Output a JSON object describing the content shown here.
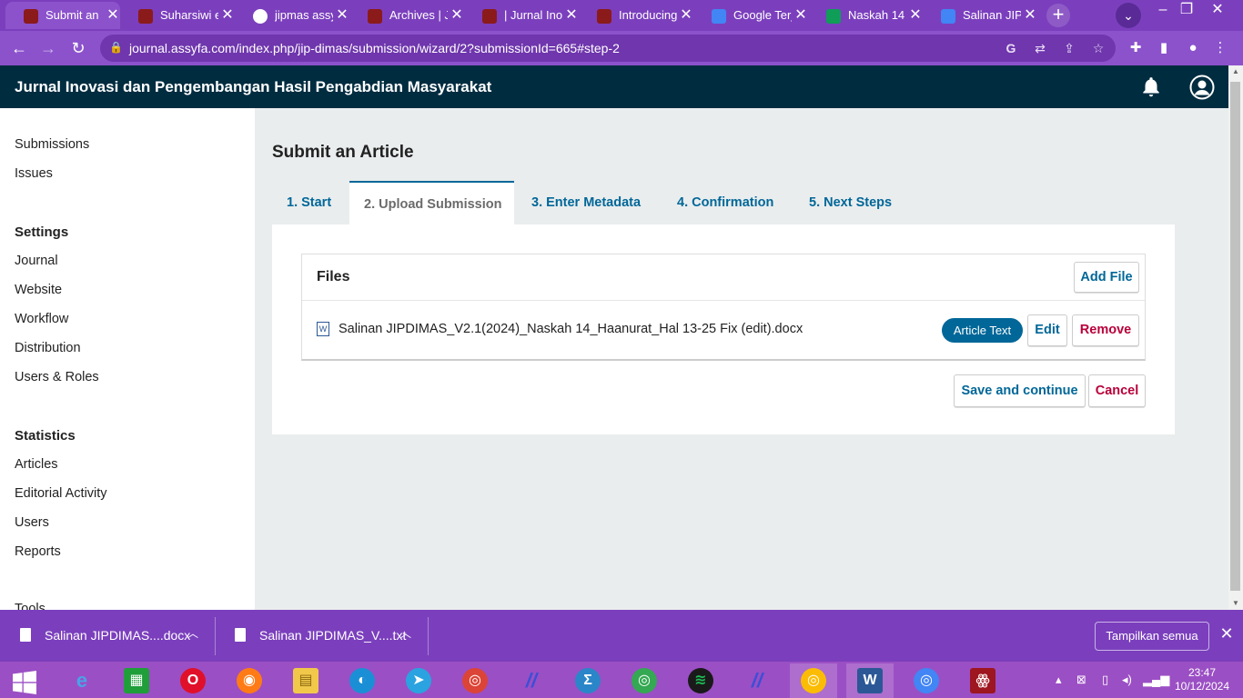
{
  "browser": {
    "tabs": [
      {
        "title": "Submit an Article",
        "fav": "#8b1a1a"
      },
      {
        "title": "Suharsiwi et al",
        "fav": "#8b1a1a"
      },
      {
        "title": "jipmas assyfa",
        "fav": "#4285f4"
      },
      {
        "title": "Archives | Jurnal",
        "fav": "#8b1a1a"
      },
      {
        "title": "| Jurnal Inovasi",
        "fav": "#8b1a1a"
      },
      {
        "title": "Introducing",
        "fav": "#8b1a1a"
      },
      {
        "title": "Google Terjemahan",
        "fav": "#4285f4"
      },
      {
        "title": "Naskah 14",
        "fav": "#0f9d58"
      },
      {
        "title": "Salinan JIPDIMAS",
        "fav": "#4285f4"
      }
    ],
    "new_tab": "+",
    "url": "journal.assyfa.com/index.php/jip-dimas/submission/wizard/2?submissionId=665#step-2"
  },
  "header": {
    "title": "Jurnal Inovasi dan Pengembangan Hasil Pengabdian Masyarakat"
  },
  "sidebar": {
    "top_items": [
      "Submissions",
      "Issues"
    ],
    "settings_heading": "Settings",
    "settings_items": [
      "Journal",
      "Website",
      "Workflow",
      "Distribution",
      "Users & Roles"
    ],
    "statistics_heading": "Statistics",
    "statistics_items": [
      "Articles",
      "Editorial Activity",
      "Users",
      "Reports"
    ],
    "tools_item": "Tools"
  },
  "main": {
    "page_title": "Submit an Article",
    "steps": [
      "1. Start",
      "2. Upload Submission",
      "3. Enter Metadata",
      "4. Confirmation",
      "5. Next Steps"
    ],
    "current_step": 1,
    "files": {
      "heading": "Files",
      "add_file": "Add File",
      "file_name": "Salinan JIPDIMAS_V2.1(2024)_Naskah 14_Haanurat_Hal 13-25 Fix (edit).docx",
      "file_type_badge": "Article Text",
      "edit": "Edit",
      "remove": "Remove",
      "doc_icon_letter": "W"
    },
    "save_continue": "Save and continue",
    "cancel": "Cancel"
  },
  "downloads": {
    "items": [
      "Salinan JIPDIMAS....docx",
      "Salinan JIPDIMAS_V....txt"
    ],
    "show_all": "Tampilkan semua"
  },
  "taskbar": {
    "time": "23:47",
    "date": "10/12/2024"
  },
  "colors": {
    "accent": "#006798",
    "danger": "#b8003a",
    "header_bg": "#002c40",
    "browser_chrome": "#8c52cc"
  }
}
